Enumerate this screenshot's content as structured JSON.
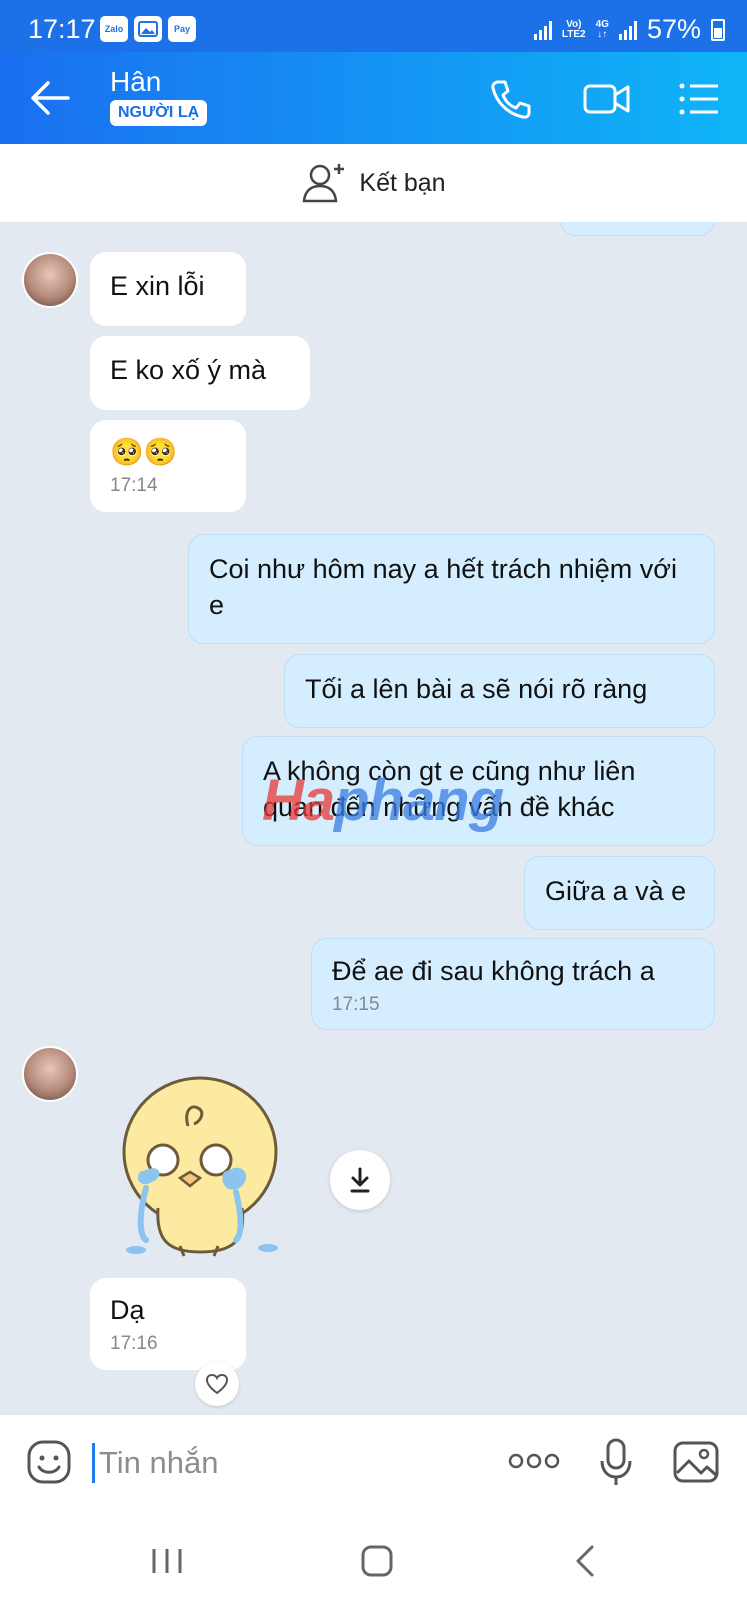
{
  "status_bar": {
    "time": "17:17",
    "app_icons": [
      "Zalo",
      "Gallery",
      "Pay"
    ],
    "network": "Vo) LTE2 4G",
    "battery": "57%"
  },
  "header": {
    "contact_name": "Hân",
    "tag": "NGƯỜI LẠ",
    "icons": [
      "back-arrow-icon",
      "phone-icon",
      "video-call-icon",
      "menu-list-icon"
    ]
  },
  "add_friend": {
    "label": "Kết bạn"
  },
  "messages": [
    {
      "side": "in",
      "text": "E xin lỗi"
    },
    {
      "side": "in",
      "text": "E ko xố ý mà"
    },
    {
      "side": "in",
      "text": "🥺🥺",
      "time": "17:14"
    },
    {
      "side": "out",
      "text": "Coi như hôm nay a hết trách nhiệm với e"
    },
    {
      "side": "out",
      "text": "Tối a lên bài a sẽ nói rõ ràng"
    },
    {
      "side": "out",
      "text": "A không còn gt e cũng như liên quan đến những vấn đề khác"
    },
    {
      "side": "out",
      "text": "Giữa a và e"
    },
    {
      "side": "out",
      "text": "Để ae đi sau không trách a",
      "time": "17:15"
    },
    {
      "side": "in",
      "type": "sticker",
      "icon": "crying-chick-sticker"
    },
    {
      "side": "in",
      "text": "Dạ",
      "time": "17:16"
    }
  ],
  "watermark": {
    "part1": "Ha",
    "part2": "phang"
  },
  "composer": {
    "placeholder": "Tin nhắn",
    "icons": [
      "emoji-icon",
      "more-dots-icon",
      "microphone-icon",
      "image-icon"
    ]
  },
  "nav": {
    "icons": [
      "recents-icon",
      "home-icon",
      "back-icon"
    ]
  },
  "colors": {
    "header_start": "#1a6ff0",
    "header_end": "#0fb5f7",
    "outgoing_bubble": "#d5eeff",
    "chat_bg": "#e2e9f1"
  }
}
